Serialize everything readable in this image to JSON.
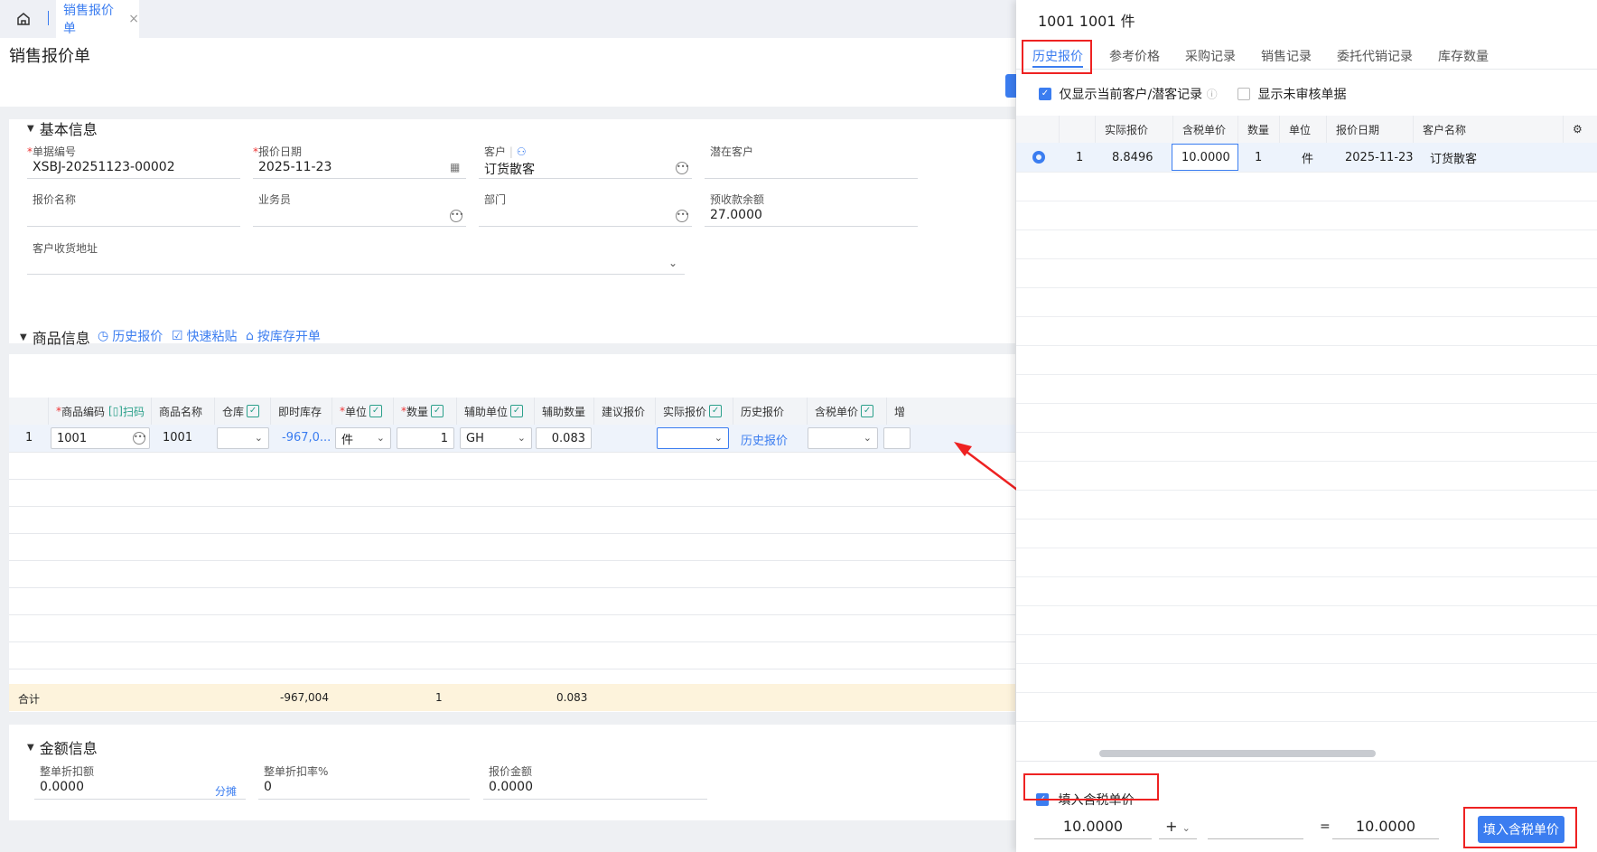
{
  "tabs": {
    "home_icon": "home-icon",
    "active_tab": "销售报价单",
    "close": "×"
  },
  "page": {
    "title": "销售报价单"
  },
  "basic": {
    "title": "基本信息",
    "fields": [
      {
        "label": "单据编号",
        "required": "*",
        "value": "XSBJ-20251123-00002"
      },
      {
        "label": "报价日期",
        "required": "*",
        "value": "2025-11-23"
      },
      {
        "label": "客户",
        "value": "订货散客"
      },
      {
        "label": "潜在客户",
        "value": ""
      },
      {
        "label": "报价名称",
        "value": ""
      },
      {
        "label": "业务员",
        "value": ""
      },
      {
        "label": "部门",
        "value": ""
      },
      {
        "label": "预收款余额",
        "value": "27.0000"
      },
      {
        "label": "客户收货地址",
        "value": ""
      }
    ]
  },
  "goods": {
    "title": "商品信息",
    "tools": [
      "历史报价",
      "快速粘贴",
      "按库存开单"
    ],
    "headers": [
      "商品编码",
      "扫码",
      "商品名称",
      "仓库",
      "即时库存",
      "单位",
      "数量",
      "辅助单位",
      "辅助数量",
      "建议报价",
      "实际报价",
      "历史报价",
      "含税单价",
      "增"
    ],
    "required_mark": "*",
    "row": {
      "index": "1",
      "code": "1001",
      "name": "1001",
      "stock": "-967,0...",
      "unit": "件",
      "qty": "1",
      "aux_unit": "GH",
      "aux_qty": "0.083",
      "history_link": "历史报价"
    },
    "sum": {
      "label": "合计",
      "stock": "-967,004",
      "qty": "1",
      "aux_qty": "0.083"
    }
  },
  "amount": {
    "title": "金额信息",
    "fields": [
      {
        "label": "整单折扣额",
        "value": "0.0000",
        "link": "分摊"
      },
      {
        "label": "整单折扣率%",
        "value": "0"
      },
      {
        "label": "报价金额",
        "value": "0.0000"
      }
    ]
  },
  "panel": {
    "title": "1001 1001 件",
    "tabs": [
      "历史报价",
      "参考价格",
      "采购记录",
      "销售记录",
      "委托代销记录",
      "库存数量"
    ],
    "opt1": "仅显示当前客户/潜客记录",
    "opt2": "显示未审核单据",
    "headers": [
      "实际报价",
      "含税单价",
      "数量",
      "单位",
      "报价日期",
      "客户名称"
    ],
    "row": {
      "idx": "1",
      "actual": "8.8496",
      "tax_price": "10.0000",
      "qty": "1",
      "unit": "件",
      "date": "2025-11-23",
      "customer": "订货散客"
    },
    "fill_check": "填入含税单价",
    "formula": {
      "left": "10.0000",
      "op": "+",
      "right": "",
      "eq": "=",
      "result": "10.0000"
    },
    "fill_button": "填入含税单价"
  },
  "colors": {
    "accent": "#3b7df0",
    "highlight": "#e22222",
    "sum_bg": "#fdf3dc"
  }
}
